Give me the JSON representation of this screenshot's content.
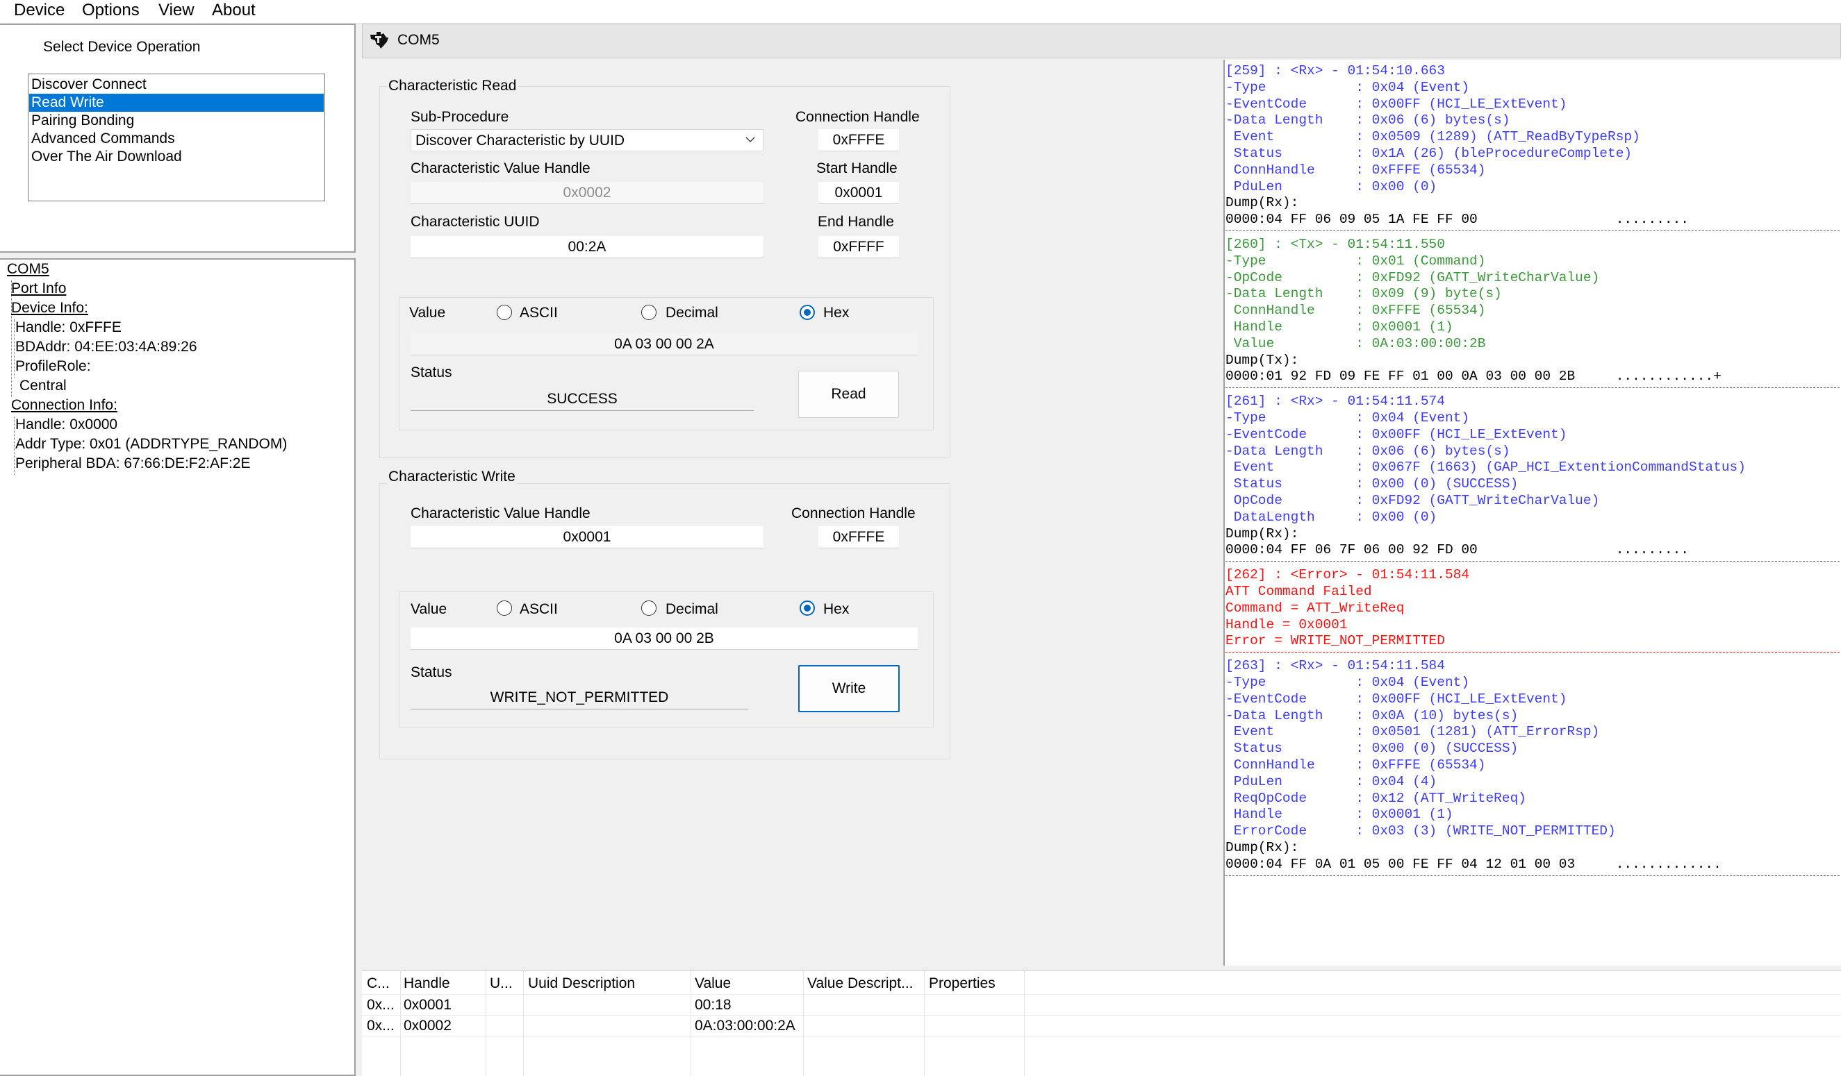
{
  "menu": [
    "Device",
    "Options",
    "View",
    "About"
  ],
  "operations": {
    "title": "Select Device Operation",
    "items": [
      "Discover Connect",
      "Read Write",
      "Pairing Bonding",
      "Advanced Commands",
      "Over The Air Download"
    ],
    "selected": "Read Write"
  },
  "device_tree": {
    "root": "COM5",
    "port_info": "Port Info",
    "device_info": "Device Info:",
    "handle": "Handle: 0xFFFE",
    "bdaddr": "BDAddr: 04:EE:03:4A:89:26",
    "profile_role": "ProfileRole:",
    "role": "Central",
    "connection_info": "Connection Info:",
    "conn_handle": "Handle: 0x0000",
    "addr_type": "Addr Type: 0x01 (ADDRTYPE_RANDOM)",
    "peripheral_bda": "Peripheral BDA: 67:66:DE:F2:AF:2E"
  },
  "tab": {
    "title": "COM5"
  },
  "char_read": {
    "group_title": "Characteristic Read",
    "sub_procedure_label": "Sub-Procedure",
    "sub_procedure_value": "Discover Characteristic by UUID",
    "conn_handle_label": "Connection Handle",
    "conn_handle_value": "0xFFFE",
    "value_handle_label": "Characteristic Value Handle",
    "value_handle_value": "0x0002",
    "start_handle_label": "Start Handle",
    "start_handle_value": "0x0001",
    "uuid_label": "Characteristic UUID",
    "uuid_value": "00:2A",
    "end_handle_label": "End Handle",
    "end_handle_value": "0xFFFF",
    "value_label": "Value",
    "radio_ascii": "ASCII",
    "radio_decimal": "Decimal",
    "radio_hex": "Hex",
    "value_data": "0A 03 00 00 2A",
    "status_label": "Status",
    "status_value": "SUCCESS",
    "read_button": "Read"
  },
  "char_write": {
    "group_title": "Characteristic Write",
    "value_handle_label": "Characteristic Value Handle",
    "value_handle_value": "0x0001",
    "conn_handle_label": "Connection Handle",
    "conn_handle_value": "0xFFFE",
    "value_label": "Value",
    "radio_ascii": "ASCII",
    "radio_decimal": "Decimal",
    "radio_hex": "Hex",
    "value_data": "0A 03 00 00 2B",
    "status_label": "Status",
    "status_value": "WRITE_NOT_PERMITTED",
    "write_button": "Write"
  },
  "log": [
    {
      "color": "blue",
      "text": "[259] : <Rx> - 01:54:10.663"
    },
    {
      "color": "blue",
      "text": "-Type           : 0x04 (Event)"
    },
    {
      "color": "blue",
      "text": "-EventCode      : 0x00FF (HCI_LE_ExtEvent)"
    },
    {
      "color": "blue",
      "text": "-Data Length    : 0x06 (6) bytes(s)"
    },
    {
      "color": "blue",
      "text": " Event          : 0x0509 (1289) (ATT_ReadByTypeRsp)"
    },
    {
      "color": "blue",
      "text": " Status         : 0x1A (26) (bleProcedureComplete)"
    },
    {
      "color": "blue",
      "text": " ConnHandle     : 0xFFFE (65534)"
    },
    {
      "color": "blue",
      "text": " PduLen         : 0x00 (0)"
    },
    {
      "color": "blk",
      "text": "Dump(Rx):"
    },
    {
      "color": "blk",
      "text": "0000:04 FF 06 09 05 1A FE FF 00                 ........."
    },
    {
      "color": "sep",
      "text": ""
    },
    {
      "color": "green",
      "text": "[260] : <Tx> - 01:54:11.550"
    },
    {
      "color": "green",
      "text": "-Type           : 0x01 (Command)"
    },
    {
      "color": "green",
      "text": "-OpCode         : 0xFD92 (GATT_WriteCharValue)"
    },
    {
      "color": "green",
      "text": "-Data Length    : 0x09 (9) byte(s)"
    },
    {
      "color": "green",
      "text": " ConnHandle     : 0xFFFE (65534)"
    },
    {
      "color": "green",
      "text": " Handle         : 0x0001 (1)"
    },
    {
      "color": "green",
      "text": " Value          : 0A:03:00:00:2B"
    },
    {
      "color": "blk",
      "text": "Dump(Tx):"
    },
    {
      "color": "blk",
      "text": "0000:01 92 FD 09 FE FF 01 00 0A 03 00 00 2B     ............+"
    },
    {
      "color": "sep",
      "text": ""
    },
    {
      "color": "blue",
      "text": "[261] : <Rx> - 01:54:11.574"
    },
    {
      "color": "blue",
      "text": "-Type           : 0x04 (Event)"
    },
    {
      "color": "blue",
      "text": "-EventCode      : 0x00FF (HCI_LE_ExtEvent)"
    },
    {
      "color": "blue",
      "text": "-Data Length    : 0x06 (6) bytes(s)"
    },
    {
      "color": "blue",
      "text": " Event          : 0x067F (1663) (GAP_HCI_ExtentionCommandStatus)"
    },
    {
      "color": "blue",
      "text": " Status         : 0x00 (0) (SUCCESS)"
    },
    {
      "color": "blue",
      "text": " OpCode         : 0xFD92 (GATT_WriteCharValue)"
    },
    {
      "color": "blue",
      "text": " DataLength     : 0x00 (0)"
    },
    {
      "color": "blk",
      "text": "Dump(Rx):"
    },
    {
      "color": "blk",
      "text": "0000:04 FF 06 7F 06 00 92 FD 00                 ........."
    },
    {
      "color": "sep",
      "text": ""
    },
    {
      "color": "red",
      "text": "[262] : <Error> - 01:54:11.584"
    },
    {
      "color": "red",
      "text": "ATT Command Failed"
    },
    {
      "color": "red",
      "text": "Command = ATT_WriteReq"
    },
    {
      "color": "red",
      "text": "Handle = 0x0001"
    },
    {
      "color": "red",
      "text": "Error = WRITE_NOT_PERMITTED"
    },
    {
      "color": "sepred",
      "text": ""
    },
    {
      "color": "blue",
      "text": "[263] : <Rx> - 01:54:11.584"
    },
    {
      "color": "blue",
      "text": "-Type           : 0x04 (Event)"
    },
    {
      "color": "blue",
      "text": "-EventCode      : 0x00FF (HCI_LE_ExtEvent)"
    },
    {
      "color": "blue",
      "text": "-Data Length    : 0x0A (10) bytes(s)"
    },
    {
      "color": "blue",
      "text": " Event          : 0x0501 (1281) (ATT_ErrorRsp)"
    },
    {
      "color": "blue",
      "text": " Status         : 0x00 (0) (SUCCESS)"
    },
    {
      "color": "blue",
      "text": " ConnHandle     : 0xFFFE (65534)"
    },
    {
      "color": "blue",
      "text": " PduLen         : 0x04 (4)"
    },
    {
      "color": "blue",
      "text": " ReqOpCode      : 0x12 (ATT_WriteReq)"
    },
    {
      "color": "blue",
      "text": " Handle         : 0x0001 (1)"
    },
    {
      "color": "blue",
      "text": " ErrorCode      : 0x03 (3) (WRITE_NOT_PERMITTED)"
    },
    {
      "color": "blk",
      "text": "Dump(Rx):"
    },
    {
      "color": "blk",
      "text": "0000:04 FF 0A 01 05 00 FE FF 04 12 01 00 03     ............."
    },
    {
      "color": "sep",
      "text": ""
    }
  ],
  "table": {
    "headers": [
      "C...",
      "Handle",
      "U...",
      "Uuid Description",
      "Value",
      "Value Descript...",
      "Properties"
    ],
    "rows": [
      [
        "0x...",
        "0x0001",
        "",
        "",
        "00:18",
        "",
        ""
      ],
      [
        "0x...",
        "0x0002",
        "",
        "",
        "0A:03:00:00:2A",
        "",
        ""
      ]
    ]
  },
  "colors": {
    "selection": "#0078d7",
    "rx": "#3c3cff",
    "tx": "#3a9a3a",
    "error": "#ff1010",
    "radio": "#0067c0"
  }
}
